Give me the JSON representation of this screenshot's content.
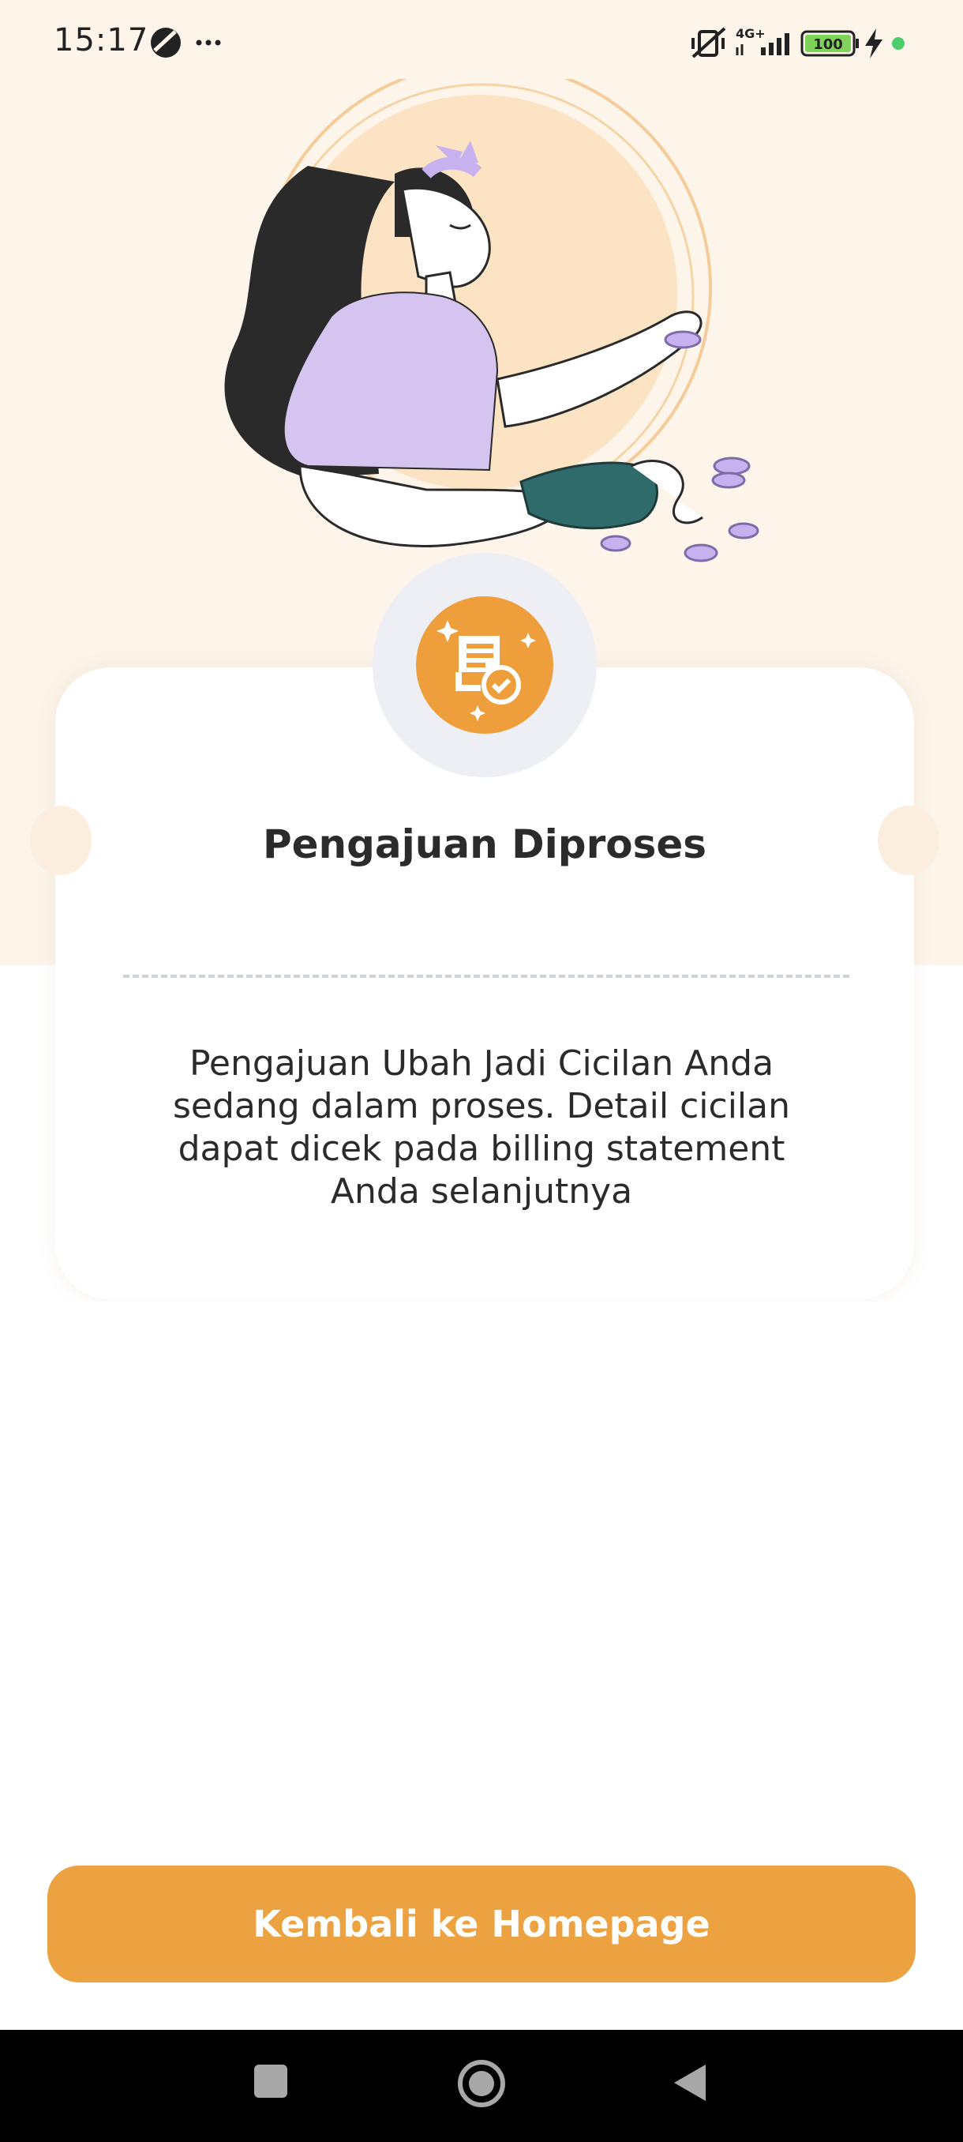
{
  "status_bar": {
    "time": "15:17",
    "left_icons": [
      "dnd-moon-icon",
      "more-dots-icon"
    ],
    "right_icons": [
      "vibrate-muted-icon",
      "4g-signal-icon",
      "battery-icon",
      "charging-icon",
      "dot-icon"
    ],
    "network": "4G+",
    "battery": "100"
  },
  "card": {
    "icon": "document-check-icon",
    "title": "Pengajuan Diproses",
    "message": "Pengajuan Ubah Jadi Cicilan Anda sedang dalam proses. Detail cicilan dapat dicek pada billing statement Anda selanjutnya"
  },
  "actions": {
    "home_button_label": "Kembali ke Homepage"
  },
  "nav_bar": {
    "buttons": [
      "recents-icon",
      "home-icon",
      "back-icon"
    ]
  },
  "colors": {
    "accent": "#eda241",
    "hero_background": "#fdf5ea",
    "lavender": "#d6c4f0",
    "teal": "#2f6b6a"
  }
}
